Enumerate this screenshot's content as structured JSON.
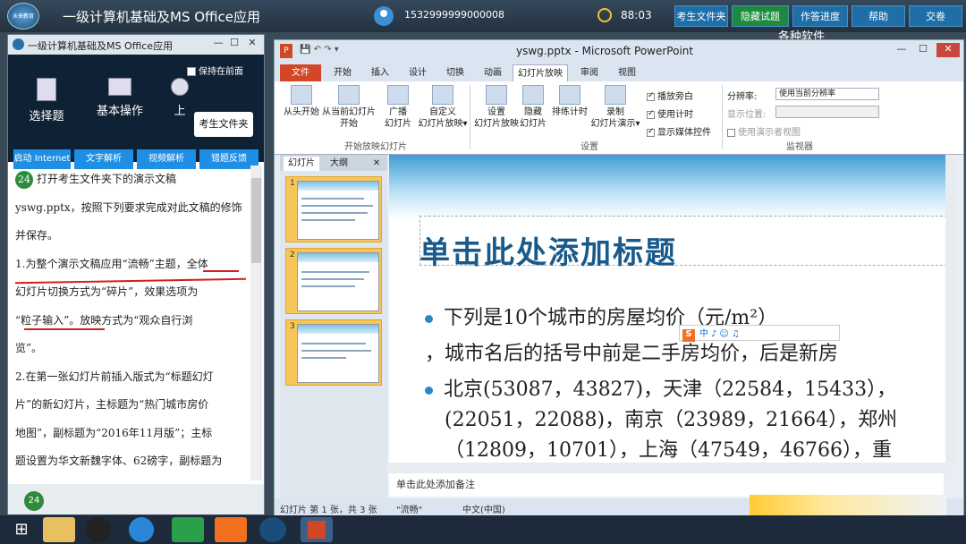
{
  "topbar": {
    "logo_text": "未来教育",
    "title": "一级计算机基础及MS Office应用",
    "user_id": "1532999999000008",
    "timer": "88:03",
    "buttons": [
      "考生文件夹",
      "隐藏试题",
      "作答进度",
      "帮助",
      "交卷"
    ],
    "behind_text": "各种软件"
  },
  "question_window": {
    "title": "一级计算机基础及MS Office应用",
    "keep_front": "保持在前面",
    "tools": [
      "选择题",
      "基本操作",
      "上"
    ],
    "kaosheng_button": "考生文件夹",
    "tabs": [
      "启动 Internet",
      "文字解析",
      "视频解析",
      "错题反馈"
    ],
    "question_number": "24",
    "paragraphs": [
      "打开考生文件夹下的演示文稿",
      "yswg.pptx，按照下列要求完成对此文稿的修饰",
      "并保存。",
      "1.为整个演示文稿应用“流畅”主题，全体",
      "幻灯片切换方式为“碎片”，效果选项为",
      "“粒子输入”。放映方式为“观众自行浏",
      "览”。",
      "2.在第一张幻灯片前插入版式为“标题幻灯",
      "片”的新幻灯片，主标题为“热门城市房价",
      "地图”，副标题为“2016年11月版”；主标",
      "题设置为华文新魏字体、62磅字，副标题为"
    ],
    "footer_number": "24"
  },
  "powerpoint": {
    "window_title": "yswg.pptx - Microsoft PowerPoint",
    "logo": "P",
    "tabs": [
      "文件",
      "开始",
      "插入",
      "设计",
      "切换",
      "动画",
      "幻灯片放映",
      "审阅",
      "视图"
    ],
    "ribbon": {
      "group1_buttons": [
        "从头开始",
        "从当前幻灯片\n开始",
        "广播\n幻灯片",
        "自定义\n幻灯片放映▾"
      ],
      "group1_label": "开始放映幻灯片",
      "group2_buttons": [
        "设置\n幻灯片放映",
        "隐藏\n幻灯片",
        "排练计时",
        "录制\n幻灯片演示▾"
      ],
      "group2_checks": [
        "播放旁白",
        "使用计时",
        "显示媒体控件"
      ],
      "group2_label": "设置",
      "monitor_resolution_label": "分辨率:",
      "monitor_resolution_value": "使用当前分辨率",
      "monitor_display_label": "显示位置:",
      "monitor_presenter": "使用演示者视图",
      "group3_label": "监视器"
    },
    "pane_tabs": [
      "幻灯片",
      "大纲"
    ],
    "slides": [
      "1",
      "2",
      "3"
    ],
    "slide": {
      "title": "单击此处添加标题",
      "lines": [
        "下列是10个城市的房屋均价（元/m²）",
        "，城市名后的括号中前是二手房均价，后是新房",
        "北京(53087，43827)，天津（22584，15433），",
        "(22051，22088)，南京（23989，21664），郑州",
        "（12809，10701），上海（47549，46766），重"
      ]
    },
    "ime": [
      "中",
      "♪",
      "☺",
      "♫"
    ],
    "notes": "单击此处添加备注",
    "status": {
      "slide_info": "幻灯片 第 1 张，共 3 张",
      "theme": "\"流畅\"",
      "language": "中文(中国)"
    }
  }
}
